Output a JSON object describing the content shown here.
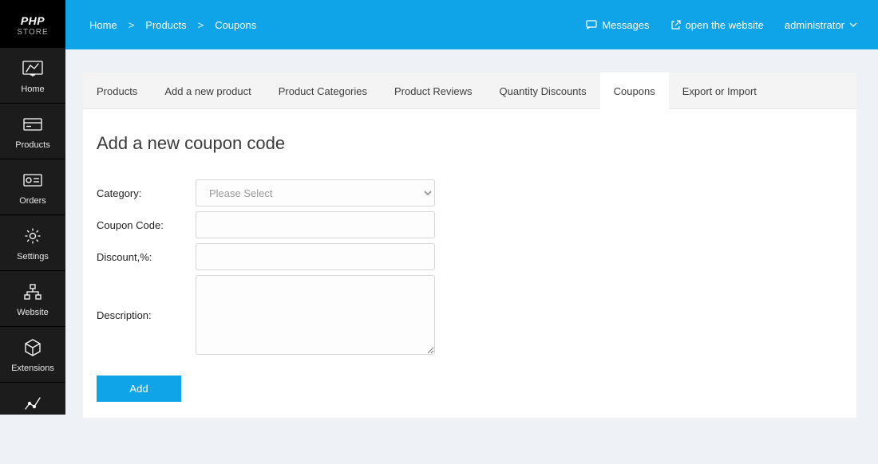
{
  "logo": {
    "title": "PHP",
    "sub": "STORE"
  },
  "sidebar": [
    {
      "label": "Home"
    },
    {
      "label": "Products"
    },
    {
      "label": "Orders"
    },
    {
      "label": "Settings"
    },
    {
      "label": "Website"
    },
    {
      "label": "Extensions"
    }
  ],
  "breadcrumb": {
    "home": "Home",
    "products": "Products",
    "coupons": "Coupons",
    "sep": ">"
  },
  "topbar": {
    "messages": "Messages",
    "open_site": "open the website",
    "user": "administrator"
  },
  "tabs": {
    "products": "Products",
    "add_product": "Add a new product",
    "categories": "Product Categories",
    "reviews": "Product Reviews",
    "qty_discounts": "Quantity Discounts",
    "coupons": "Coupons",
    "export_import": "Export or Import"
  },
  "form": {
    "title": "Add a new coupon code",
    "category_label": "Category:",
    "category_placeholder": "Please Select",
    "code_label": "Coupon Code:",
    "discount_label": "Discount,%:",
    "description_label": "Description:",
    "submit": "Add"
  }
}
